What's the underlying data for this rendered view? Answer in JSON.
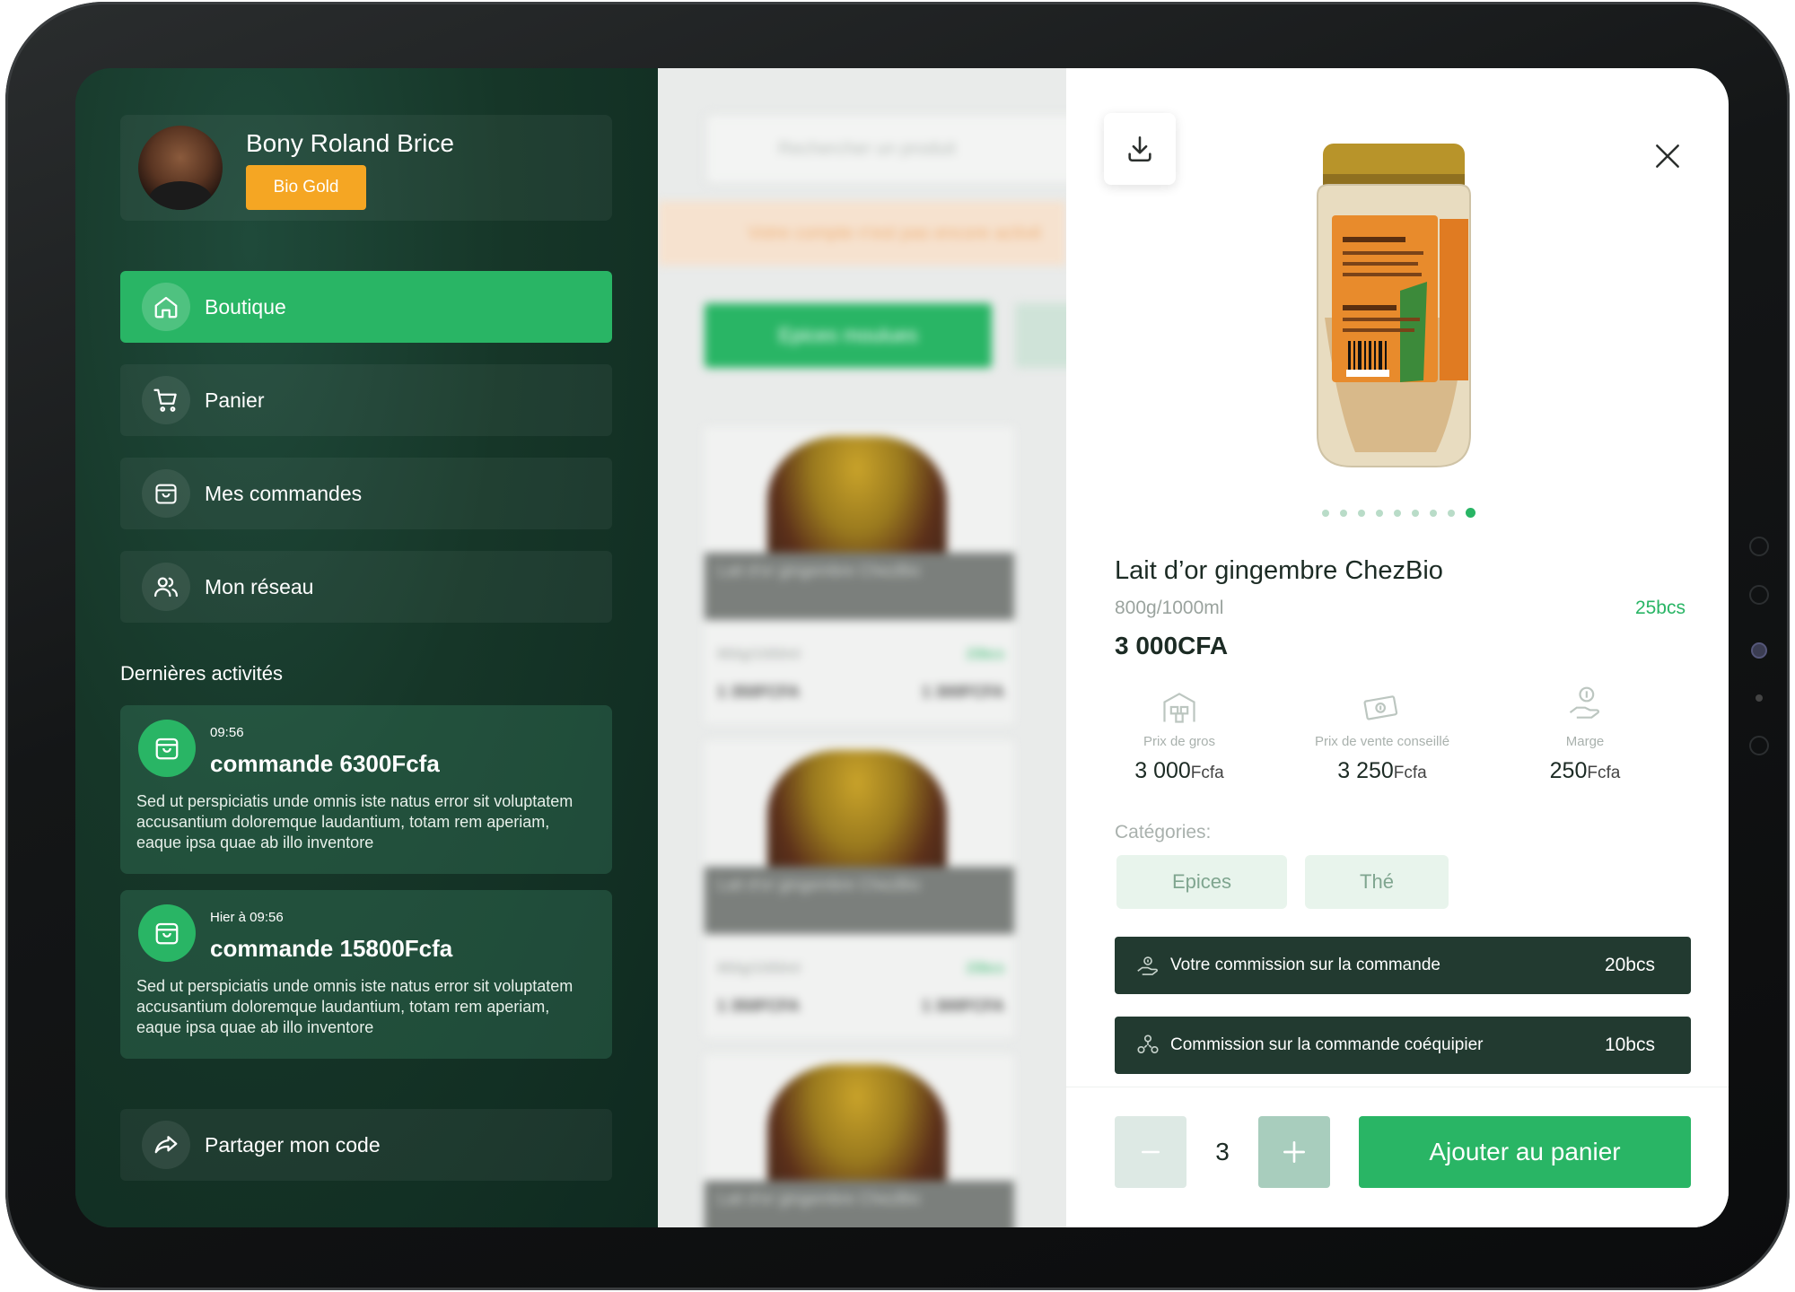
{
  "colors": {
    "accent": "#29b565",
    "badge": "#f5a623",
    "sidebar": "#163628",
    "commission_bar": "#223a30"
  },
  "profile": {
    "name": "Bony Roland Brice",
    "badge": "Bio Gold"
  },
  "nav": {
    "items": [
      {
        "label": "Boutique",
        "icon": "home-icon",
        "active": true
      },
      {
        "label": "Panier",
        "icon": "cart-icon",
        "active": false
      },
      {
        "label": "Mes commandes",
        "icon": "bag-icon",
        "active": false
      },
      {
        "label": "Mon réseau",
        "icon": "users-icon",
        "active": false
      }
    ]
  },
  "activities": {
    "title": "Dernières activités",
    "items": [
      {
        "time": "09:56",
        "title": "commande 6300Fcfa",
        "desc": "Sed ut perspiciatis unde omnis iste natus error sit voluptatem accusantium doloremque laudantium, totam rem aperiam, eaque ipsa quae ab illo inventore"
      },
      {
        "time": "Hier à 09:56",
        "title": "commande 15800Fcfa",
        "desc": "Sed ut perspiciatis unde omnis iste natus error sit voluptatem accusantium doloremque laudantium, totam rem aperiam, eaque ipsa quae ab illo inventore"
      }
    ]
  },
  "share": {
    "label": "Partager mon code",
    "icon": "share-icon"
  },
  "catalog": {
    "search_placeholder": "Rechercher un produit",
    "warning": "Votre compte n'est pas encore activé",
    "category": "Epices moulues",
    "card": {
      "name": "Lait d'or gingembre ChezBio",
      "qty": "800g/1000ml",
      "bcs": "20bcs",
      "price_a": "1 350FCFA",
      "price_b": "1 300FCFA"
    }
  },
  "product": {
    "title": "Lait d’or gingembre ChezBio",
    "quantity": "800g/1000ml",
    "bcs": "25bcs",
    "price": "3 000CFA",
    "image_count": 9,
    "image_active": 9,
    "stats": [
      {
        "label": "Prix de gros",
        "value": "3 000",
        "unit": "Fcfa",
        "icon": "warehouse-icon"
      },
      {
        "label": "Prix de vente conseillé",
        "value": "3 250",
        "unit": "Fcfa",
        "icon": "banknote-icon"
      },
      {
        "label": "Marge",
        "value": "250",
        "unit": "Fcfa",
        "icon": "money-hand-icon"
      }
    ],
    "categories_label": "Catégories:",
    "categories": [
      "Epices",
      "Thé"
    ],
    "commissions": [
      {
        "label": "Votre commission sur la commande",
        "value": "20bcs",
        "icon": "commission-icon"
      },
      {
        "label": "Commission sur la commande coéquipier",
        "value": "10bcs",
        "icon": "team-icon"
      }
    ],
    "cart_quantity": "3",
    "add_to_cart": "Ajouter au panier"
  }
}
